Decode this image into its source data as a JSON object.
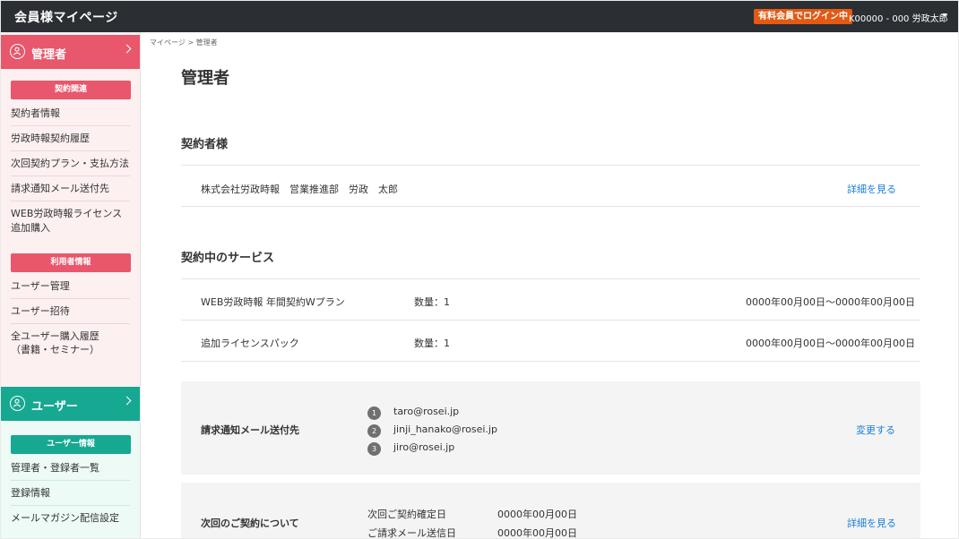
{
  "header": {
    "title": "会員様マイページ",
    "member_badge": "有料会員でログイン中",
    "user_label": "K00000 - 000  労政太郎"
  },
  "sidebar": {
    "admin": {
      "label": "管理者",
      "icon": "admin-icon",
      "groups": [
        {
          "title": "契約関連",
          "items": [
            "契約者情報",
            "労政時報契約履歴",
            "次回契約プラン・支払方法",
            "請求通知メール送付先",
            "WEB労政時報ライセンス",
            "追加購入"
          ]
        },
        {
          "title": "利用者情報",
          "items": [
            "ユーザー管理",
            "ユーザー招待",
            "全ユーザー購入履歴",
            "（書籍・セミナー）"
          ]
        }
      ]
    },
    "user": {
      "label": "ユーザー",
      "icon": "user-icon",
      "groups": [
        {
          "title": "ユーザー情報",
          "items": [
            "管理者・登録者一覧",
            "登録情報",
            "メールマガジン配信設定"
          ]
        }
      ]
    },
    "colors": {
      "admin": "#e8576b",
      "user": "#17a891"
    }
  },
  "breadcrumb": "マイページ > 管理者",
  "main": {
    "title": "管理者",
    "contractor": {
      "heading": "契約者様",
      "name": "株式会社労政時報　営業推進部　労政　太郎",
      "link": "詳細を見る"
    },
    "services": {
      "heading": "契約中のサービス",
      "rows": [
        {
          "name": "WEB労政時報 年間契約Wプラン",
          "qty": "数量：1",
          "period": "0000年00月00日〜0000年00月00日"
        },
        {
          "name": "追加ライセンスパック",
          "qty": "数量：1",
          "period": "0000年00月00日〜0000年00月00日"
        }
      ]
    },
    "billing_email": {
      "label": "請求通知メール送付先",
      "emails": [
        {
          "n": "1",
          "email": "taro@rosei.jp"
        },
        {
          "n": "2",
          "email": "jinji_hanako@rosei.jp"
        },
        {
          "n": "3",
          "email": "jiro@rosei.jp"
        }
      ],
      "link": "変更する"
    },
    "next_contract": {
      "label": "次回のご契約について",
      "rows": [
        {
          "k": "次回ご契約確定日",
          "v": "0000年00月00日"
        },
        {
          "k": "ご請求メール送信日",
          "v": "0000年00月00日"
        }
      ],
      "link": "詳細を見る"
    }
  }
}
